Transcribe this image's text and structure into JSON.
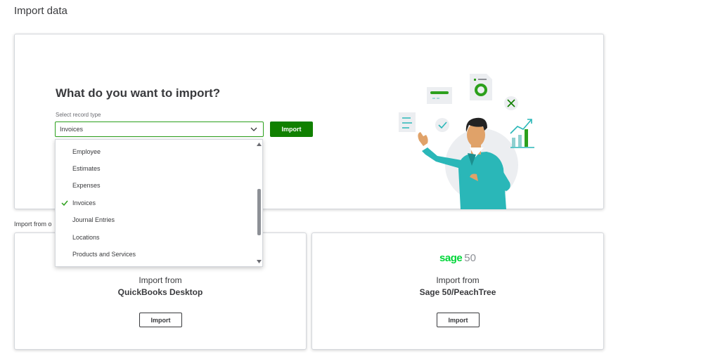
{
  "page": {
    "title": "Import data"
  },
  "hero": {
    "heading": "What do you want to import?",
    "field_label": "Select record type",
    "selected_value": "Invoices",
    "import_label": "Import"
  },
  "dropdown": {
    "items": [
      {
        "label": "Employee",
        "selected": false
      },
      {
        "label": "Estimates",
        "selected": false
      },
      {
        "label": "Expenses",
        "selected": false
      },
      {
        "label": "Invoices",
        "selected": true
      },
      {
        "label": "Journal Entries",
        "selected": false
      },
      {
        "label": "Locations",
        "selected": false
      },
      {
        "label": "Products and Services",
        "selected": false
      }
    ]
  },
  "section": {
    "label": "Import from o"
  },
  "sources": {
    "quickbooks": {
      "line1": "Import from",
      "line2": "QuickBooks Desktop",
      "import_label": "Import"
    },
    "sage": {
      "logo_word": "sage",
      "logo_num": "50",
      "line1": "Import from",
      "line2": "Sage 50/PeachTree",
      "import_label": "Import"
    }
  },
  "colors": {
    "accent": "#2ca01c",
    "primary_button": "#108000",
    "sage_green": "#00d639",
    "teal": "#2ab7b8"
  }
}
